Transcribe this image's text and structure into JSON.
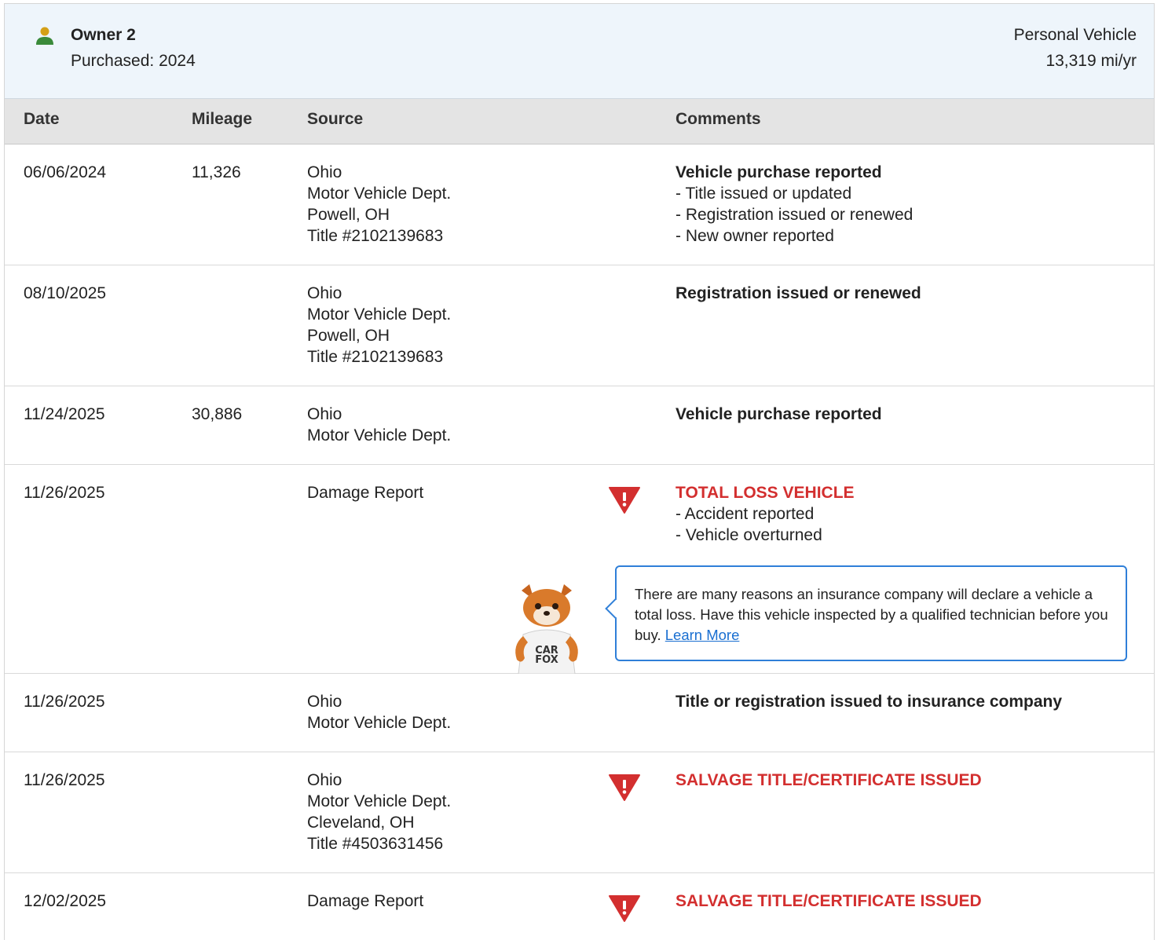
{
  "owner": {
    "name": "Owner 2",
    "purchased": "Purchased: 2024",
    "vehicle_type": "Personal Vehicle",
    "miles_per_year": "13,319 mi/yr",
    "icon": "person-icon",
    "icon_colors": {
      "head": "#d4a017",
      "body": "#3a8a3a"
    }
  },
  "columns": {
    "date": "Date",
    "mileage": "Mileage",
    "source": "Source",
    "comments": "Comments"
  },
  "rows": [
    {
      "date": "06/06/2024",
      "mileage": "11,326",
      "source": [
        "Ohio",
        "Motor Vehicle Dept.",
        "Powell, OH",
        "Title #2102139683"
      ],
      "title": "Vehicle purchase reported",
      "lines": [
        "- Title issued or updated",
        "- Registration issued or renewed",
        "- New owner reported"
      ]
    },
    {
      "date": "08/10/2025",
      "mileage": "",
      "source": [
        "Ohio",
        "Motor Vehicle Dept.",
        "Powell, OH",
        "Title #2102139683"
      ],
      "title": "Registration issued or renewed"
    },
    {
      "date": "11/24/2025",
      "mileage": "30,886",
      "source": [
        "Ohio",
        "Motor Vehicle Dept."
      ],
      "title": "Vehicle purchase reported"
    },
    {
      "date": "11/26/2025",
      "mileage": "",
      "source": [
        "Damage Report"
      ],
      "alert": "TOTAL LOSS VEHICLE",
      "lines": [
        "- Accident reported",
        "- Vehicle overturned"
      ],
      "tip": {
        "text": "There are many reasons an insurance company will declare a vehicle a total loss. Have this vehicle inspected by a qualified technician before you buy.",
        "link": "Learn More",
        "mascot_shirt_line1": "CAR",
        "mascot_shirt_line2": "FOX"
      }
    },
    {
      "date": "11/26/2025",
      "mileage": "",
      "source": [
        "Ohio",
        "Motor Vehicle Dept."
      ],
      "title": "Title or registration issued to insurance company"
    },
    {
      "date": "11/26/2025",
      "mileage": "",
      "source": [
        "Ohio",
        "Motor Vehicle Dept.",
        "Cleveland, OH",
        "Title #4503631456"
      ],
      "alert": "SALVAGE TITLE/CERTIFICATE ISSUED"
    },
    {
      "date": "12/02/2025",
      "mileage": "",
      "source": [
        "Damage Report"
      ],
      "alert": "SALVAGE TITLE/CERTIFICATE ISSUED"
    }
  ],
  "colors": {
    "alert": "#d32f2f",
    "link": "#1a6fd1",
    "header_bg": "#eef5fb",
    "table_head_bg": "#e4e4e4"
  }
}
